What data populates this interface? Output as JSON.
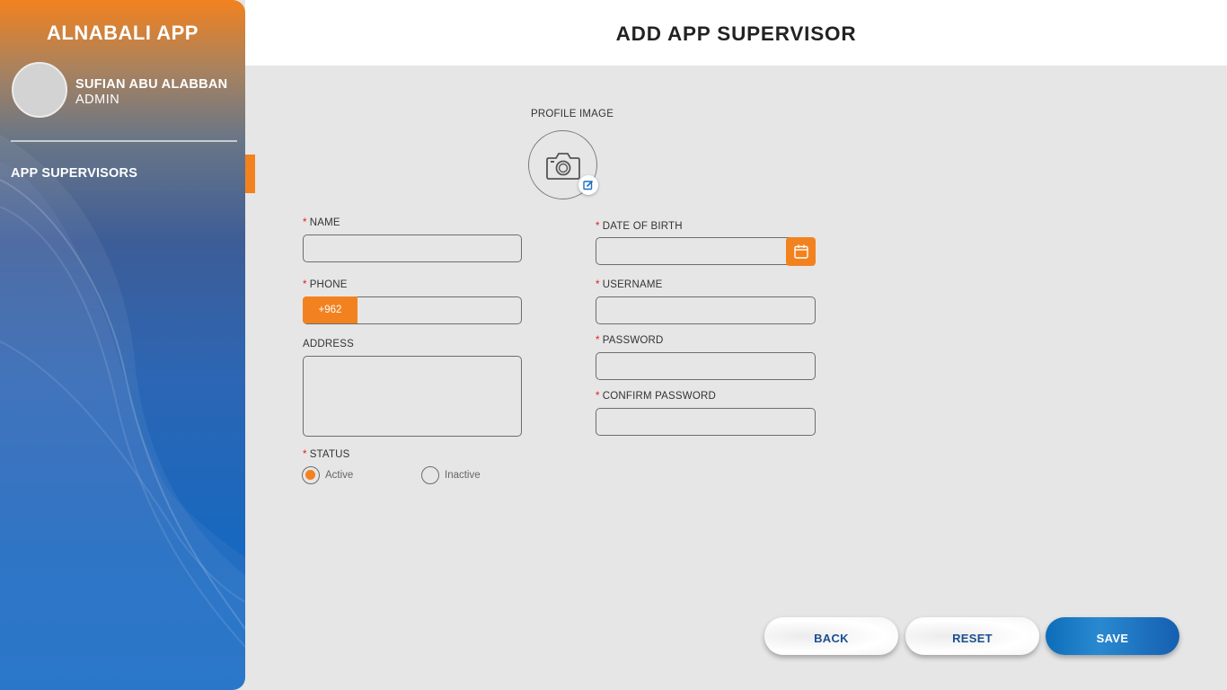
{
  "sidebar": {
    "app_title": "ALNABALI APP",
    "user_name": "SUFIAN ABU ALABBAN",
    "user_role": "ADMIN",
    "menu": [
      {
        "label": "APP SUPERVISORS",
        "active": true
      }
    ]
  },
  "header": {
    "title": "ADD APP SUPERVISOR"
  },
  "form": {
    "profile_image_label": "PROFILE IMAGE",
    "name_label": "NAME",
    "dob_label": "DATE OF BIRTH",
    "phone_label": "PHONE",
    "phone_code": "+962",
    "username_label": "USERNAME",
    "address_label": "ADDRESS",
    "password_label": "PASSWORD",
    "confirm_password_label": "CONFIRM PASSWORD",
    "status_label": "STATUS",
    "status_options": [
      {
        "label": "Active",
        "selected": true
      },
      {
        "label": "Inactive",
        "selected": false
      }
    ],
    "required_mark": "*",
    "values": {
      "name": "",
      "dob": "",
      "phone": "",
      "username": "",
      "address": "",
      "password": "",
      "confirm_password": ""
    }
  },
  "buttons": {
    "back": "BACK",
    "reset": "RESET",
    "save": "SAVE"
  },
  "colors": {
    "accent": "#f2821f",
    "primary": "#1668c0",
    "background": "#e6e6e6",
    "required": "#e0201f"
  },
  "icons": [
    "camera-icon",
    "edit-icon",
    "calendar-icon"
  ]
}
